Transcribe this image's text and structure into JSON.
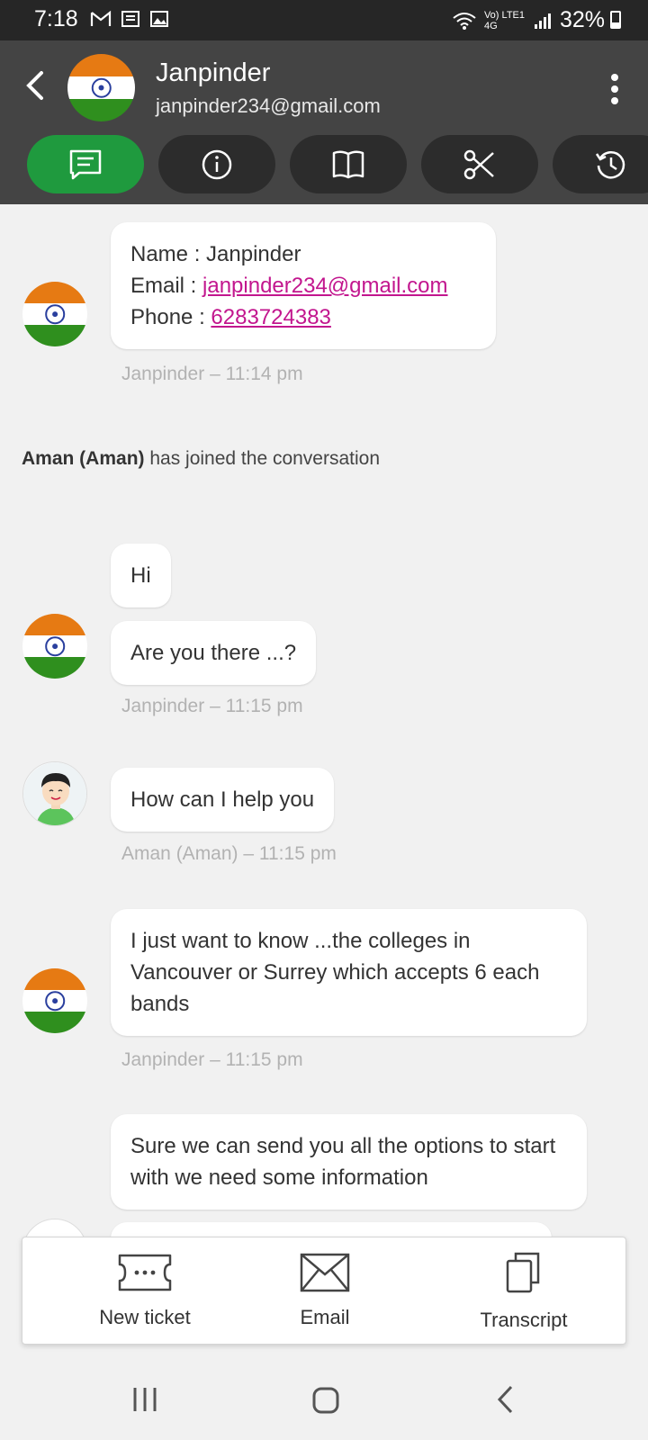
{
  "status": {
    "time": "7:18",
    "network": "Vo) LTE1 4G",
    "battery": "32%"
  },
  "header": {
    "name": "Janpinder",
    "email": "janpinder234@gmail.com",
    "tabs": [
      "chat-icon",
      "info-icon",
      "book-icon",
      "scissors-icon",
      "history-icon"
    ]
  },
  "messages": {
    "m1": {
      "name_line": "Name : Janpinder",
      "email_prefix": "Email : ",
      "email": "janpinder234@gmail.com",
      "phone_prefix": "Phone : ",
      "phone": "6283724383",
      "meta": "Janpinder – 11:14 pm"
    },
    "system": {
      "agent": "Aman (Aman)",
      "text": " has joined the conversation"
    },
    "m2": {
      "text": "Hi"
    },
    "m3": {
      "text": "Are you there ...?",
      "meta": "Janpinder – 11:15 pm"
    },
    "m4": {
      "text": "How can I help you",
      "meta": "Aman (Aman) – 11:15 pm"
    },
    "m5": {
      "text": "I just want to know ...the colleges in Vancouver or Surrey which accepts 6 each bands",
      "meta": "Janpinder – 11:15 pm"
    },
    "m6": {
      "text": "Sure we can send you all the options to start with we need some information"
    }
  },
  "actions": {
    "new_ticket": "New ticket",
    "email": "Email",
    "transcript": "Transcript"
  },
  "colors": {
    "accent": "#1f9a3e",
    "header": "#444444",
    "link": "#c2168e"
  }
}
